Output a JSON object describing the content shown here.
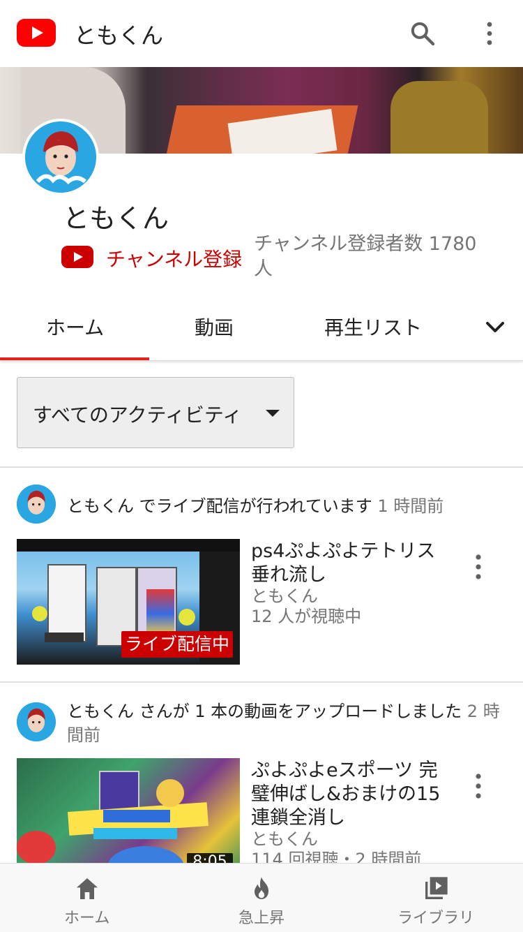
{
  "app": {
    "title": "ともくん",
    "icons": {
      "logo": "youtube-logo-icon",
      "search": "search-icon",
      "more": "more-vert-icon"
    },
    "colors": {
      "brand_red": "#ff0000",
      "subscribe_red": "#cc0000",
      "tab_underline": "#e62117"
    }
  },
  "channel": {
    "name": "ともくん",
    "subscribe_label": "チャンネル登録",
    "subscriber_count": "チャンネル登録者数 1780 人"
  },
  "tabs": [
    {
      "label": "ホーム",
      "active": true
    },
    {
      "label": "動画",
      "active": false
    },
    {
      "label": "再生リスト",
      "active": false
    }
  ],
  "filter": {
    "selected": "すべてのアクティビティ"
  },
  "activities": [
    {
      "text": "ともくん でライブ配信が行われています",
      "time": "1 時間前",
      "video": {
        "title": "ps4ぷよぷよテトリス　垂れ流し",
        "channel": "ともくん",
        "stats": "12 人が視聴中",
        "badge": "ライブ配信中"
      }
    },
    {
      "text": "ともくん さんが 1 本の動画をアップロードしました",
      "time": "2 時間前",
      "video": {
        "title": "ぷよぷよeスポーツ 完璧伸ばし&おまけの15連鎖全消し",
        "channel": "ともくん",
        "stats": "114 回視聴・2 時間前",
        "duration": "8:05"
      }
    }
  ],
  "bottom_nav": [
    {
      "label": "ホーム",
      "icon": "home-icon"
    },
    {
      "label": "急上昇",
      "icon": "trending-flame-icon"
    },
    {
      "label": "ライブラリ",
      "icon": "library-icon"
    }
  ]
}
